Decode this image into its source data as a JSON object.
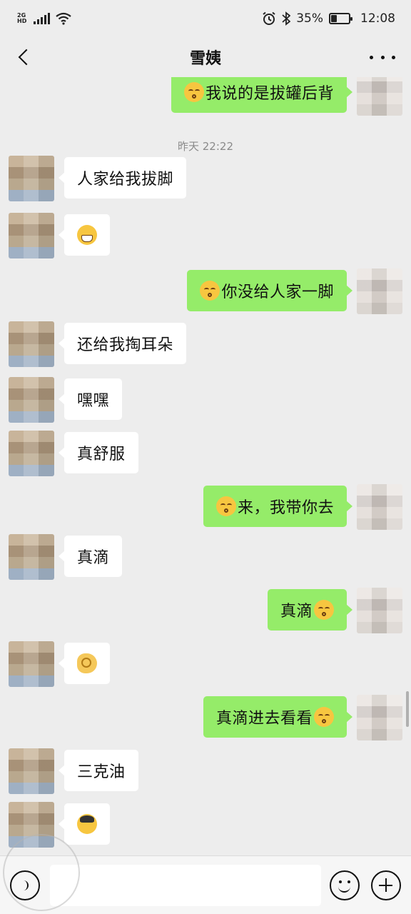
{
  "status_bar": {
    "network": "2G",
    "network_sub": "HD",
    "battery": "35%",
    "battery_level": 0.35,
    "time": "12:08",
    "icons": [
      "signal-icon",
      "wifi-icon",
      "alarm-icon",
      "bluetooth-icon",
      "battery-icon"
    ]
  },
  "header": {
    "title": "雪姨",
    "back_icon": "chevron-left-icon",
    "more_icon": "more-dots-icon"
  },
  "messages": [
    {
      "side": "right",
      "text": "我说的是拔罐后背",
      "emoji": "kiss-emoji",
      "emoji_pos": "before"
    },
    {
      "type": "timestamp",
      "text": "昨天 22:22"
    },
    {
      "side": "left",
      "text": "人家给我拔脚"
    },
    {
      "side": "left",
      "text": "",
      "emoji": "grin-emoji"
    },
    {
      "side": "right",
      "text": "你没给人家一脚",
      "emoji": "kiss-emoji",
      "emoji_pos": "before"
    },
    {
      "side": "left",
      "text": "还给我掏耳朵"
    },
    {
      "side": "left",
      "text": "嘿嘿"
    },
    {
      "side": "left",
      "text": "真舒服"
    },
    {
      "side": "right",
      "text": "来，我带你去",
      "emoji": "kiss-emoji",
      "emoji_pos": "before"
    },
    {
      "side": "left",
      "text": "真滴"
    },
    {
      "side": "right",
      "text": "真滴",
      "emoji": "kiss-emoji",
      "emoji_pos": "after"
    },
    {
      "side": "left",
      "text": "",
      "emoji": "ok-hand-emoji"
    },
    {
      "side": "right",
      "text": "真滴进去看看",
      "emoji": "kiss-emoji",
      "emoji_pos": "after"
    },
    {
      "side": "left",
      "text": "三克油"
    },
    {
      "side": "left",
      "text": "",
      "emoji": "facepalm-emoji"
    }
  ],
  "input_bar": {
    "voice_icon": "voice-icon",
    "input_placeholder": "",
    "emoji_icon": "smiley-icon",
    "plus_icon": "plus-icon"
  }
}
